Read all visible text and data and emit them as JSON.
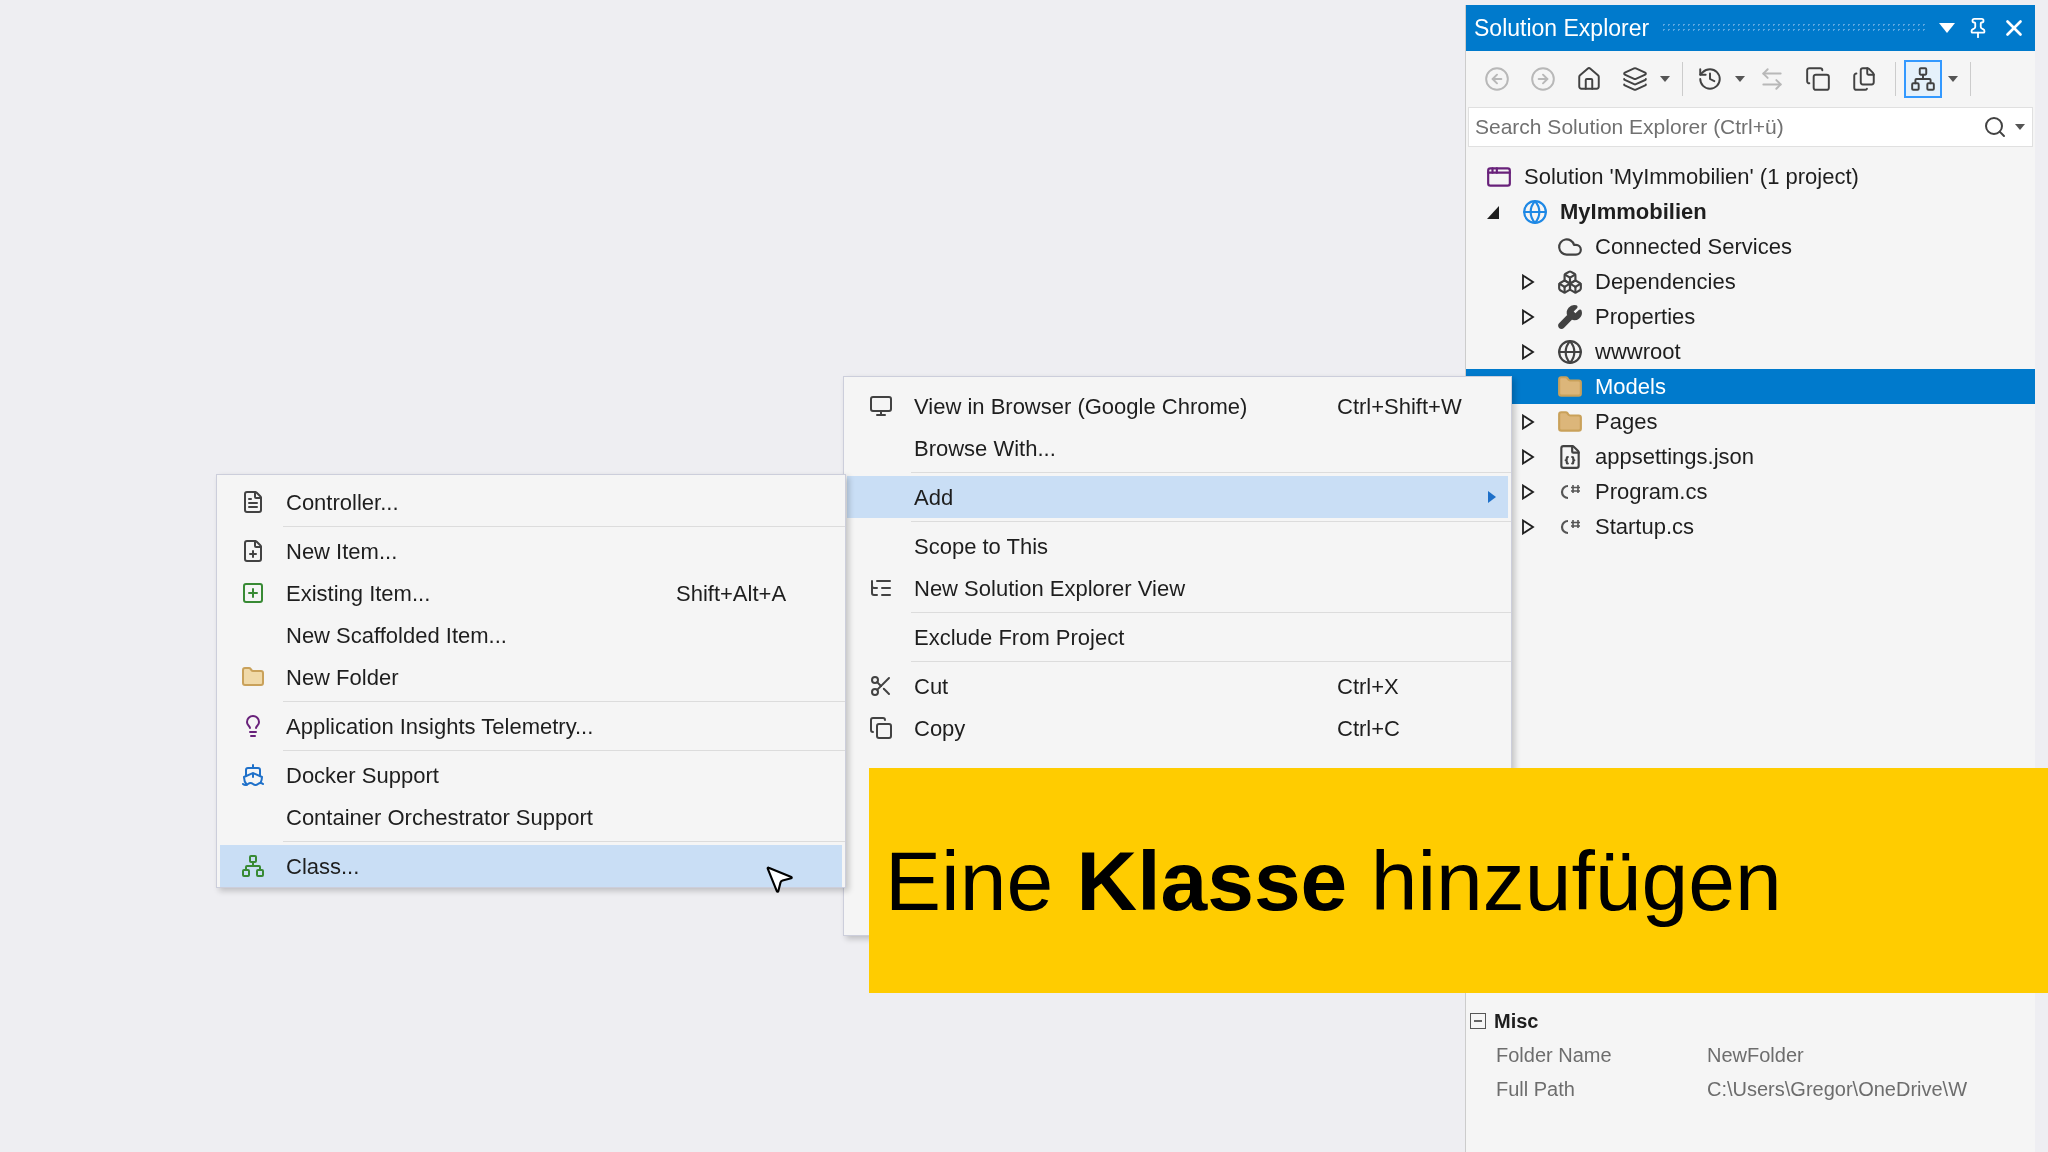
{
  "solution_explorer": {
    "title": "Solution Explorer",
    "toolbar": [
      {
        "kind": "back",
        "disabled": true,
        "selected": false
      },
      {
        "kind": "forward",
        "disabled": true,
        "selected": false
      },
      {
        "kind": "home",
        "disabled": false,
        "selected": false
      },
      {
        "kind": "switch-views",
        "disabled": false,
        "selected": false
      },
      {
        "kind": "history",
        "disabled": false,
        "selected": false
      },
      {
        "kind": "sync",
        "disabled": true,
        "selected": false
      },
      {
        "kind": "collapse",
        "disabled": false,
        "selected": false
      },
      {
        "kind": "show-all",
        "disabled": false,
        "selected": false
      },
      {
        "kind": "preview",
        "disabled": false,
        "selected": true
      }
    ],
    "search": {
      "placeholder": "Search Solution Explorer (Ctrl+ü)"
    },
    "tree": [
      {
        "label": "Solution 'MyImmobilien' (1 project)",
        "kind": "solution",
        "selected": false,
        "children": [
          {
            "label": "MyImmobilien",
            "kind": "project",
            "selected": false,
            "expanded": true,
            "children": [
              {
                "label": "Connected Services",
                "kind": "service",
                "selected": false
              },
              {
                "label": "Dependencies",
                "kind": "dependencies",
                "selected": false,
                "expanded": false
              },
              {
                "label": "Properties",
                "kind": "properties",
                "selected": false,
                "expanded": false
              },
              {
                "label": "wwwroot",
                "kind": "web",
                "selected": false,
                "expanded": false
              },
              {
                "label": "Models",
                "kind": "folder",
                "selected": true
              },
              {
                "label": "Pages",
                "kind": "folder",
                "selected": false,
                "expanded": false
              },
              {
                "label": "appsettings.json",
                "kind": "json",
                "selected": false,
                "expanded": false
              },
              {
                "label": "Program.cs",
                "kind": "csharp",
                "selected": false,
                "expanded": false
              },
              {
                "label": "Startup.cs",
                "kind": "csharp",
                "selected": false,
                "expanded": false
              }
            ]
          }
        ]
      }
    ],
    "properties": {
      "section": "Misc",
      "expanded": true,
      "rows": [
        {
          "name": "Folder Name",
          "value": "NewFolder"
        },
        {
          "name": "Full Path",
          "value": "C:\\Users\\Gregor\\OneDrive\\W"
        }
      ]
    }
  },
  "context_menu": {
    "groups": [
      {
        "items": [
          {
            "kind": "browser",
            "label": "View in Browser (Google Chrome)",
            "shortcut": "Ctrl+Shift+W",
            "selected": false
          },
          {
            "kind": "plain",
            "label": "Browse With...",
            "selected": false
          }
        ]
      },
      {
        "items": [
          {
            "kind": "submenu",
            "label": "Add",
            "selected": true
          }
        ]
      },
      {
        "items": [
          {
            "kind": "plain",
            "label": "Scope to This",
            "selected": false
          },
          {
            "kind": "explorer-view",
            "label": "New Solution Explorer View",
            "selected": false
          }
        ]
      },
      {
        "items": [
          {
            "kind": "plain",
            "label": "Exclude From Project",
            "selected": false
          }
        ]
      },
      {
        "items": [
          {
            "kind": "cut",
            "label": "Cut",
            "shortcut": "Ctrl+X",
            "selected": false
          },
          {
            "kind": "copy",
            "label": "Copy",
            "shortcut": "Ctrl+C",
            "selected": false
          }
        ]
      }
    ]
  },
  "add_submenu": {
    "groups": [
      {
        "items": [
          {
            "kind": "controller",
            "label": "Controller...",
            "selected": false
          }
        ]
      },
      {
        "items": [
          {
            "kind": "new-item",
            "label": "New Item...",
            "selected": false
          },
          {
            "kind": "existing-item",
            "label": "Existing Item...",
            "shortcut": "Shift+Alt+A",
            "selected": false
          },
          {
            "kind": "plain",
            "label": "New Scaffolded Item...",
            "selected": false
          },
          {
            "kind": "new-folder",
            "label": "New Folder",
            "selected": false
          }
        ]
      },
      {
        "items": [
          {
            "kind": "insights",
            "label": "Application Insights Telemetry...",
            "selected": false
          }
        ]
      },
      {
        "items": [
          {
            "kind": "docker",
            "label": "Docker Support",
            "selected": false
          },
          {
            "kind": "plain",
            "label": "Container Orchestrator Support",
            "selected": false
          }
        ]
      },
      {
        "items": [
          {
            "kind": "class",
            "label": "Class...",
            "selected": true
          }
        ]
      }
    ]
  },
  "banner": {
    "caption": "Eine **Klasse** hinzufügen"
  }
}
